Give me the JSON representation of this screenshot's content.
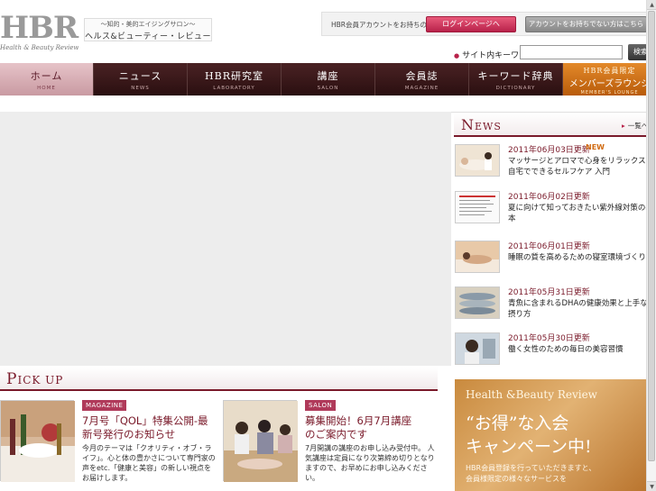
{
  "header": {
    "logo_text": "HBR",
    "logo_sub": "Health & Beauty Review",
    "tagline_top": "〜知的・美的エイジングサロン〜",
    "tagline_main": "ヘルス&ビューティー・レビュー",
    "account_question": "HBR会員アカウントをお持ちの方",
    "login_button": "ログインページへ",
    "no_account_button": "アカウントをお持ちでない方はこちら",
    "search_label": "サイト内キーワード検索",
    "search_placeholder": "",
    "search_button": "検索"
  },
  "nav": [
    {
      "label": "ホーム",
      "sub": "HOME"
    },
    {
      "label": "ニュース",
      "sub": "NEWS"
    },
    {
      "label": "HBR研究室",
      "sub": "LABORATORY"
    },
    {
      "label": "講座",
      "sub": "SALON"
    },
    {
      "label": "会員誌",
      "sub": "MAGAZINE"
    },
    {
      "label": "キーワード辞典",
      "sub": "DICTIONARY"
    }
  ],
  "nav_member": {
    "top": "HBR会員限定",
    "label": "メンバーズラウンジ",
    "sub": "MEMBER'S LOUNGE"
  },
  "pickup": {
    "heading_initial": "P",
    "heading_rest": "ICK UP",
    "cards": [
      {
        "tag": "MAGAZINE",
        "title": "7月号「QOL」特集公開-最新号発行のお知らせ",
        "body": "今月のテーマは「クオリティ・オブ・ライフ」。心と体の豊かさについて専門家の声をetc.「健康と美容」の新しい視点をお届けします。"
      },
      {
        "tag": "SALON",
        "title": "募集開始！6月7月講座のご案内です",
        "body": "7月開講の講座のお申し込み受付中。 人気講座は定員になり次第締め切りとなりますので、お早めにお申し込みください。"
      }
    ]
  },
  "news": {
    "heading_initial": "N",
    "heading_rest": "EWS",
    "more_label": "一覧へ",
    "new_badge": "NEW",
    "items": [
      {
        "date": "2011年06月03日更新",
        "title": "マッサージとアロマで心身をリラックス、自宅でできるセルフケア 入門",
        "is_new": true
      },
      {
        "date": "2011年06月02日更新",
        "title": "夏に向けて知っておきたい紫外線対策の基本"
      },
      {
        "date": "2011年06月01日更新",
        "title": "睡眠の質を高めるための寝室環境づくり"
      },
      {
        "date": "2011年05月31日更新",
        "title": "青魚に含まれるDHAの健康効果と上手な摂り方"
      },
      {
        "date": "2011年05月30日更新",
        "title": "働く女性のための毎日の美容習慣"
      }
    ]
  },
  "banner": {
    "line1": "Health &Beauty Review",
    "line2": "“お得”な入会",
    "line3": "キャンペーン中!",
    "line4": "HBR会員登録を行っていただきますと、",
    "line5": "会員様限定の様々なサービスを"
  },
  "colors": {
    "brand": "#7a1a2a",
    "nav_bg": "#2a0e0f",
    "active_nav": "#e6c3c8",
    "member_orange": "#e3892a",
    "login_pink": "#e85a7a"
  }
}
